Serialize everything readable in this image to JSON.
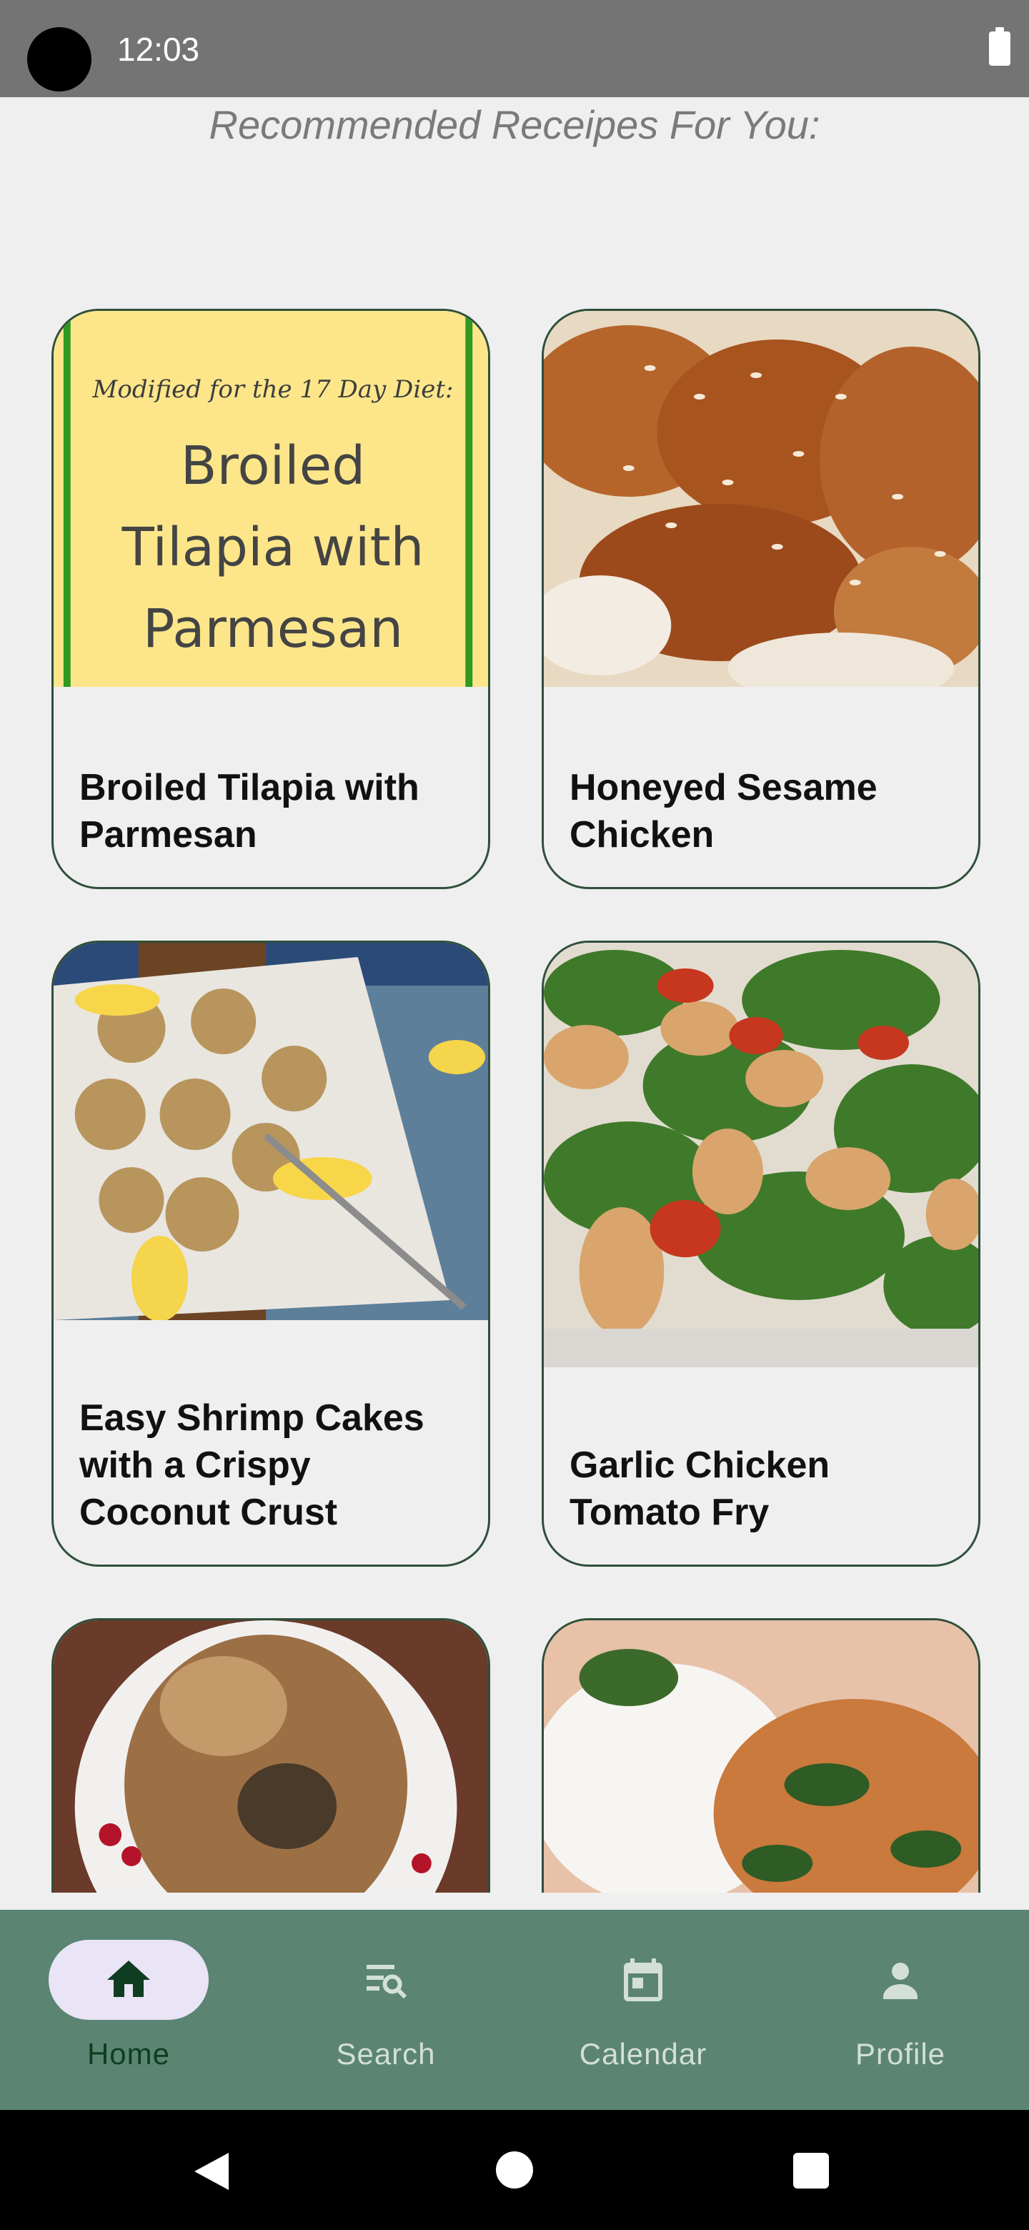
{
  "status_bar": {
    "time": "12:03"
  },
  "header": {
    "title": "Recommended Receipes For You:"
  },
  "recipes": [
    {
      "name": "Broiled Tilapia with Parmesan",
      "image": "tilapia-photo",
      "image_text": {
        "line1": "Modified for the 17 Day Diet:",
        "line2": "Broiled",
        "line3": "Tilapia with",
        "line4": "Parmesan"
      }
    },
    {
      "name": "Honeyed Sesame Chicken",
      "image": "sesame-chicken-photo"
    },
    {
      "name": "Easy Shrimp Cakes with a Crispy Coconut Crust",
      "image": "shrimp-cakes-photo"
    },
    {
      "name": "Garlic Chicken Tomato Fry",
      "image": "garlic-chicken-photo"
    },
    {
      "name": "",
      "image": "roast-turkey-photo"
    },
    {
      "name": "",
      "image": "chicken-rice-photo"
    }
  ],
  "bottom_nav": {
    "items": [
      {
        "label": "Home",
        "icon": "home-icon",
        "active": true
      },
      {
        "label": "Search",
        "icon": "search-list-icon",
        "active": false
      },
      {
        "label": "Calendar",
        "icon": "calendar-icon",
        "active": false
      },
      {
        "label": "Profile",
        "icon": "person-icon",
        "active": false
      }
    ]
  },
  "colors": {
    "nav_background": "#5b8572",
    "nav_active_pill": "#e9e4f6",
    "card_border": "#2f4f3a",
    "page_background": "#efefef"
  }
}
